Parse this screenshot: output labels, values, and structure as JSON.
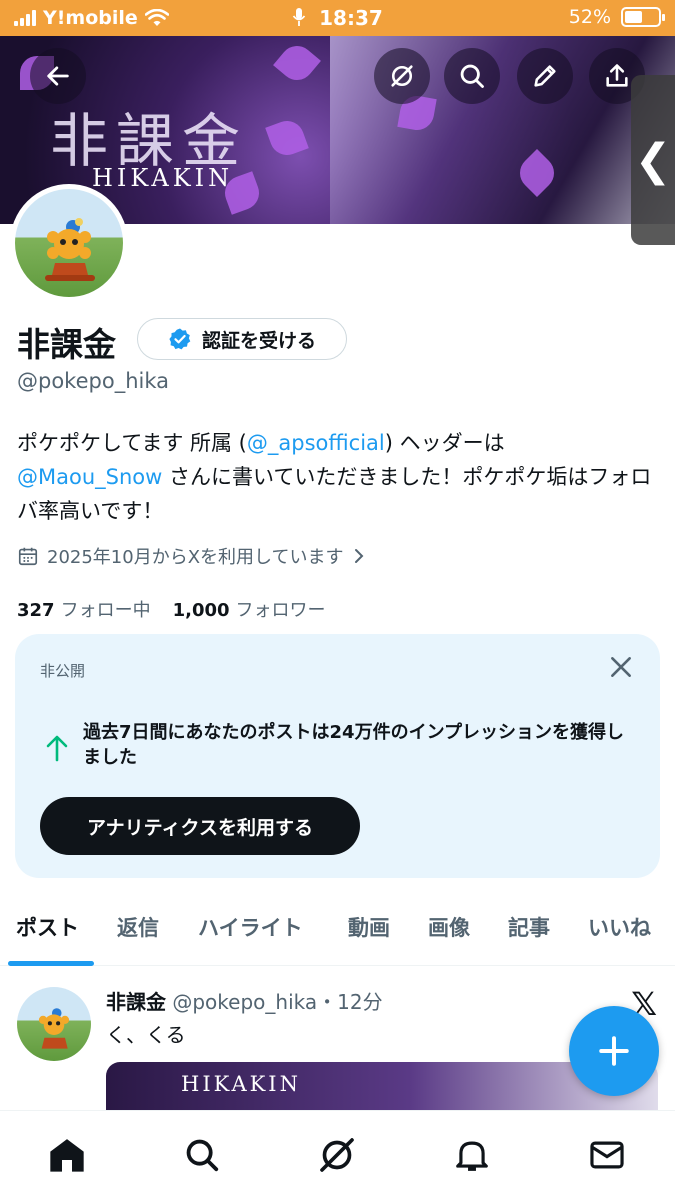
{
  "status_bar": {
    "carrier": "Y!mobile",
    "time": "18:37",
    "battery_percent": "52%",
    "battery_level": 0.52,
    "icons": [
      "signal-icon",
      "wifi-icon",
      "mic-icon",
      "battery-icon"
    ]
  },
  "banner": {
    "title": "非課金",
    "subtitle": "HIKAKIN",
    "icons": [
      "back-arrow-icon",
      "grok-icon",
      "search-icon",
      "pencil-icon",
      "share-icon"
    ],
    "side_tab_glyph": "❮"
  },
  "profile": {
    "name": "非課金",
    "verify_label": "認証を受ける",
    "handle": "@pokepo_hika",
    "bio": {
      "part1": "ポケポケしてます 所属 (",
      "link1": "@_apsofficial",
      "part2": ") ヘッダーは",
      "link2": "@Maou_Snow",
      "part3": " さんに書いていただきました！ポケポケ垢はフォロバ率高いです！"
    },
    "joined": "2025年10月からXを利用しています",
    "following_count": "327",
    "following_label": "フォロー中",
    "followers_count": "1,000",
    "followers_label": "フォロワー"
  },
  "private_card": {
    "label": "非公開",
    "message": "過去7日間にあなたのポストは24万件のインプレッションを獲得しました",
    "button": "アナリティクスを利用する"
  },
  "tabs": [
    "ポスト",
    "返信",
    "ハイライト",
    "動画",
    "画像",
    "記事",
    "いいね"
  ],
  "active_tab": "ポスト",
  "post": {
    "author": "非課金",
    "handle": "@pokepo_hika",
    "time": "・12分",
    "text": "く、くる",
    "media_caption": "HIKAKIN"
  },
  "fab_glyph": "+",
  "colors": {
    "accent": "#1d9bf0",
    "status_bar": "#f2a13c",
    "card_bg": "#e8f5fd",
    "text": "#0f1419",
    "secondary_text": "#536471"
  }
}
